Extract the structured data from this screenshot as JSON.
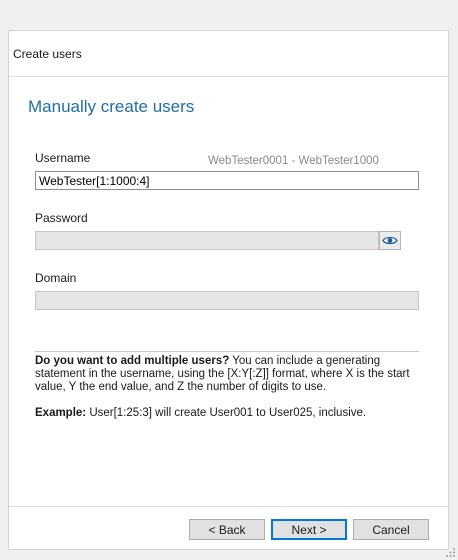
{
  "window": {
    "header_title": "Create users"
  },
  "page": {
    "title": "Manually create users"
  },
  "username": {
    "label": "Username",
    "hint": "WebTester0001 - WebTester1000",
    "value": "WebTester[1:1000:4]"
  },
  "password": {
    "label": "Password",
    "value": "",
    "toggle_icon": "eye-icon"
  },
  "domain": {
    "label": "Domain",
    "value": ""
  },
  "info": {
    "question": "Do you want to add multiple users?",
    "text": " You can include a generating statement in the username, using the [X:Y[:Z]] format, where X is the start value, Y the end value, and Z the number of digits to use.",
    "example_label": "Example:",
    "example_text": " User[1:25:3] will create User001 to User025, inclusive."
  },
  "buttons": {
    "back": "< Back",
    "next": "Next >",
    "cancel": "Cancel"
  },
  "colors": {
    "title_blue": "#1f6fa5",
    "hint_gray": "#8a8a8a",
    "primary_border": "#0078d7"
  }
}
